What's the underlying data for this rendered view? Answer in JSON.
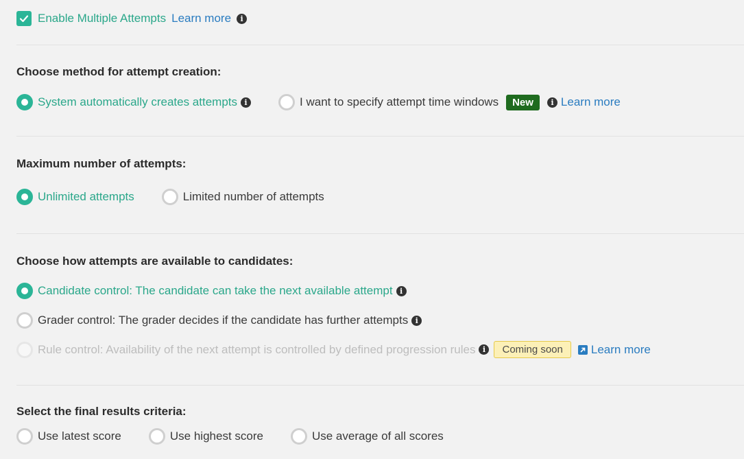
{
  "multiple_attempts": {
    "label": "Enable Multiple Attempts",
    "checked": true,
    "learn_more": "Learn more",
    "icons": {
      "checkbox": "checkmark-icon",
      "info": "info-icon"
    }
  },
  "attempt_creation": {
    "heading": "Choose method for attempt creation:",
    "options": [
      {
        "label": "System automatically creates attempts",
        "selected": true
      },
      {
        "label": "I want to specify attempt time windows",
        "selected": false,
        "badge": "New",
        "learn_more": "Learn more"
      }
    ]
  },
  "max_attempts": {
    "heading": "Maximum number of attempts:",
    "options": [
      {
        "label": "Unlimited attempts",
        "selected": true
      },
      {
        "label": "Limited number of attempts",
        "selected": false
      }
    ]
  },
  "availability": {
    "heading": "Choose how attempts are available to candidates:",
    "options": [
      {
        "label": "Candidate control: The candidate can take the next available attempt",
        "selected": true
      },
      {
        "label": "Grader control: The grader decides if the candidate has further attempts",
        "selected": false
      },
      {
        "label": "Rule control: Availability of the next attempt is controlled by defined progression rules",
        "selected": false,
        "disabled": true,
        "badge": "Coming soon",
        "learn_more": "Learn more"
      }
    ]
  },
  "final_results": {
    "heading": "Select the final results criteria:",
    "options": [
      {
        "label": "Use latest score",
        "selected": false
      },
      {
        "label": "Use highest score",
        "selected": false
      },
      {
        "label": "Use average of all scores",
        "selected": false
      }
    ]
  },
  "colors": {
    "accent": "#2bb597",
    "selected_text": "#2aa78a",
    "link": "#2a7cc0",
    "new_badge": "#1f6b1f",
    "coming_soon_badge": "#fcf0b7"
  }
}
